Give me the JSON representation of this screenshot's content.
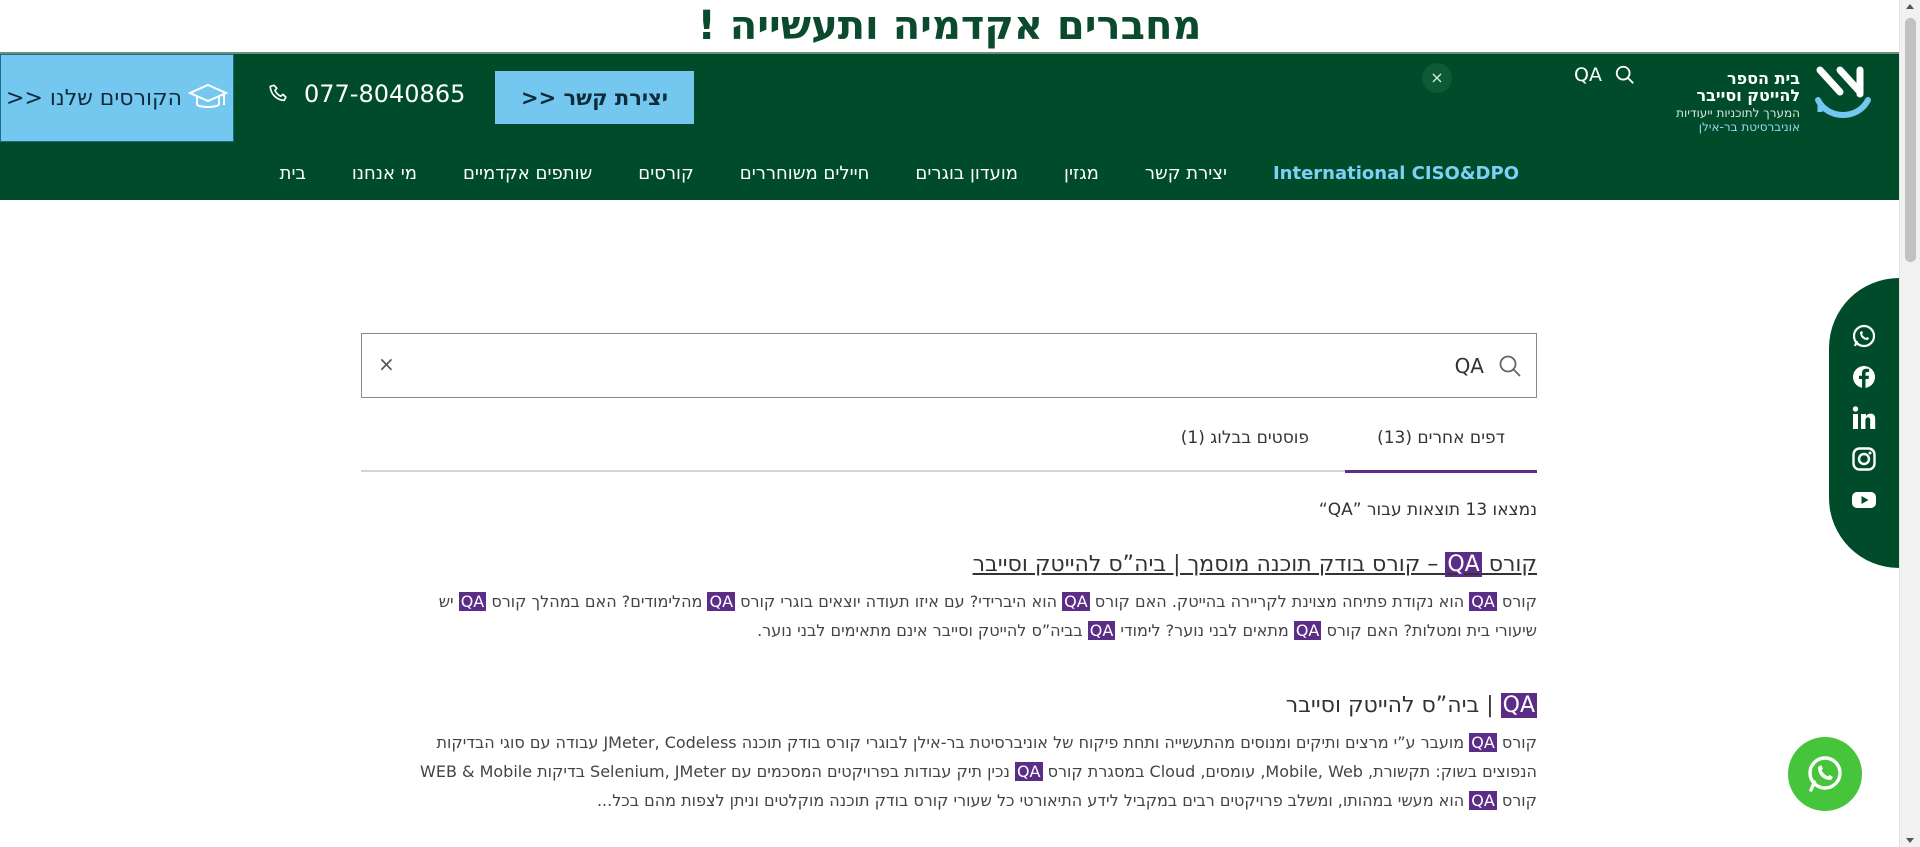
{
  "banner": {
    "title": "מחברים אקדמיה ותעשייה !"
  },
  "header": {
    "courses_label": "הקורסים שלנו <<",
    "phone": "077-8040865",
    "contact_label": "יצירת קשר <<",
    "close_symbol": "×",
    "search_query": "QA",
    "logo": {
      "line1": "בית הספר",
      "line2": "להייטק וסייבר",
      "line3": "המערך לתוכניות ייעודיות",
      "line4": "אוניברסיטת בר-אילן"
    }
  },
  "nav": {
    "items": [
      {
        "label": "בית"
      },
      {
        "label": "מי אנחנו"
      },
      {
        "label": "שותפים אקדמיים"
      },
      {
        "label": "קורסים"
      },
      {
        "label": "חיילים משוחררים"
      },
      {
        "label": "מועדון בוגרים"
      },
      {
        "label": "מגזין"
      },
      {
        "label": "יצירת קשר"
      },
      {
        "label": "International CISO&DPO"
      }
    ]
  },
  "search": {
    "value": "QA",
    "clear_symbol": "×"
  },
  "tabs": [
    {
      "label": "דפים אחרים (13)",
      "active": true
    },
    {
      "label": "פוסטים בבלוג (1)",
      "active": false
    }
  ],
  "results_count": "נמצאו 13 תוצאות עבור ”QA“",
  "results": [
    {
      "title_pre": "קורס ",
      "title_hl": "QA",
      "title_post": " – קורס בודק תוכנה מוסמך | ביה”ס להייטק וסייבר",
      "b1": "קורס ",
      "b1_hl": "QA",
      "b2": " הוא נקודת פתיחה מצוינת לקריירה בהייטק. האם קורס ",
      "b2_hl": "QA",
      "b3": " הוא היברידי? עם איזו תעודה יוצאים בוגרי קורס ",
      "b3_hl": "QA",
      "b4": " מהלימודים? האם במהלך קורס ",
      "b4_hl": "QA",
      "b5": " יש שיעורי בית ומטלות? האם קורס ",
      "b5_hl": "QA",
      "b6": " מתאים לבני נוער? לימודי ",
      "b6_hl": "QA",
      "b7": " בביה”ס להייטק וסייבר אינם מתאימים לבני נוער."
    },
    {
      "title_hl": "QA",
      "title_post": " | ביה”ס להייטק וסייבר",
      "b1": "קורס ",
      "b1_hl": "QA",
      "b2": " מועבר ע”י מרצים ותיקים ומנוסים מהתעשייה ותחת פיקוח של אוניברסיטת בר-אילן לבוגרי קורס בודק תוכנה JMeter, Codeless עבודה עם סוגי הבדיקות הנפוצים בשוק: תקשורת, Mobile, Web, עומסים, Cloud במסגרת קורס ",
      "b2_hl": "QA",
      "b3": " נכין תיק עבודות בפרויקטים המסכמים עם Selenium, JMeter בדיקות WEB & Mobile קורס ",
      "b3_hl": "QA",
      "b4": " הוא מעשי במהותו, ומשלב פרויקטים רבים במקביל לידע התיאורטי כל שעורי קורס בודק תוכנה מוקלטים וניתן לצפות מהם בכל..."
    }
  ],
  "icons": {
    "courses": "graduation-cap-icon",
    "phone": "phone-icon",
    "search": "search-icon",
    "social": [
      "whatsapp-icon",
      "facebook-icon",
      "linkedin-icon",
      "instagram-icon",
      "youtube-icon"
    ],
    "whatsapp_float": "whatsapp-icon"
  },
  "colors": {
    "brand_green": "#004c2a",
    "accent_blue": "#74c7ef",
    "highlight_purple": "#5b2d86",
    "whatsapp_green": "#45c43c"
  }
}
